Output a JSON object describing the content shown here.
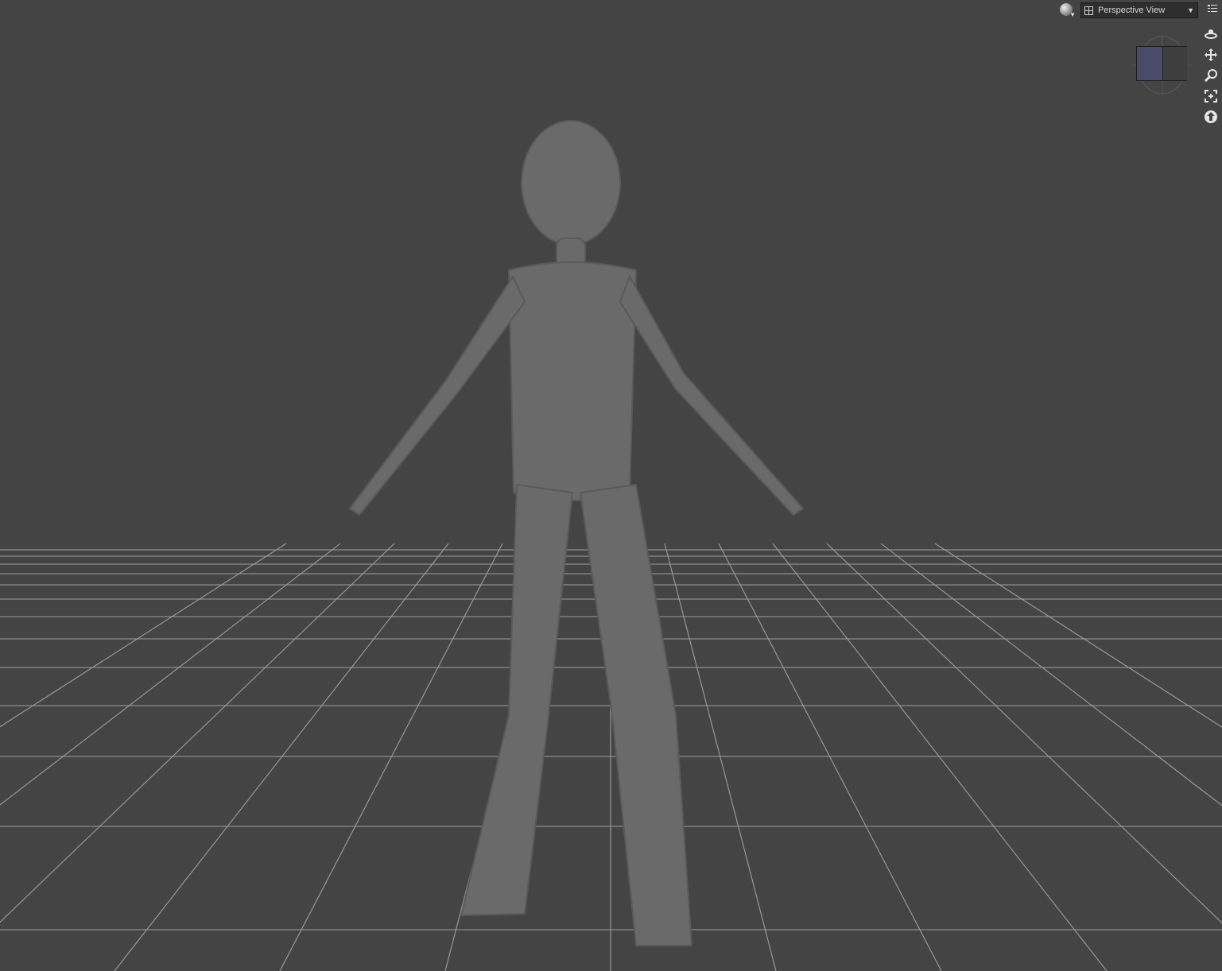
{
  "viewport": {
    "camera_selector": {
      "label": "Perspective View"
    },
    "nav_tools": [
      {
        "name": "orbit-tool",
        "icon": "orbit-icon"
      },
      {
        "name": "pan-tool",
        "icon": "pan-icon"
      },
      {
        "name": "zoom-tool",
        "icon": "zoom-icon"
      },
      {
        "name": "frame-tool",
        "icon": "frame-icon"
      },
      {
        "name": "reset-view-tool",
        "icon": "reset-view-icon"
      }
    ],
    "colors": {
      "background": "#444444",
      "grid_line": "#b0b0b0",
      "placeholder": "#6a6a6a"
    }
  }
}
